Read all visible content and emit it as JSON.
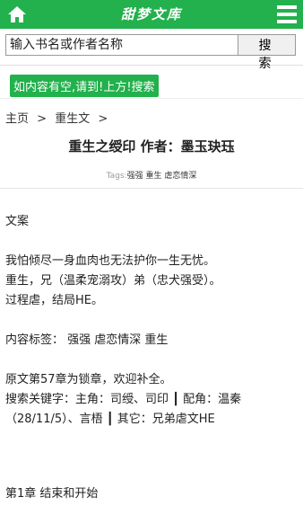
{
  "header": {
    "logo": "甜梦文库",
    "home_icon": "home-icon",
    "menu_icon": "menu-icon",
    "accent_color": "#22b14c"
  },
  "search": {
    "placeholder": "输入书名或作者名称",
    "button_label": "搜 索"
  },
  "notice": "如内容有空,请到!上方!搜索",
  "breadcrumb": [
    "主页",
    ">",
    "重生文",
    ">"
  ],
  "book": {
    "title": "重生之绶印 作者：墨玉玦珏",
    "tags_label": "Tags:",
    "tags": [
      "强强",
      "重生",
      "虐恋情深"
    ]
  },
  "content": {
    "heading": "文案",
    "intro_lines": [
      "我怕倾尽一身血肉也无法护你一生无忧。",
      "重生，兄（温柔宠溺攻）弟（忠犬强受）。",
      "过程虐，结局HE。"
    ],
    "tags_line": "内容标签： 强强 虐恋情深 重生",
    "notes_lines": [
      "原文第57章为锁章，欢迎补全。",
      "搜索关键字：主角：司绶、司印 ┃ 配角：温秦",
      "（28/11/5）、言梧 ┃ 其它：兄弟虐文HE"
    ]
  },
  "chapter": "第1章 结束和开始"
}
